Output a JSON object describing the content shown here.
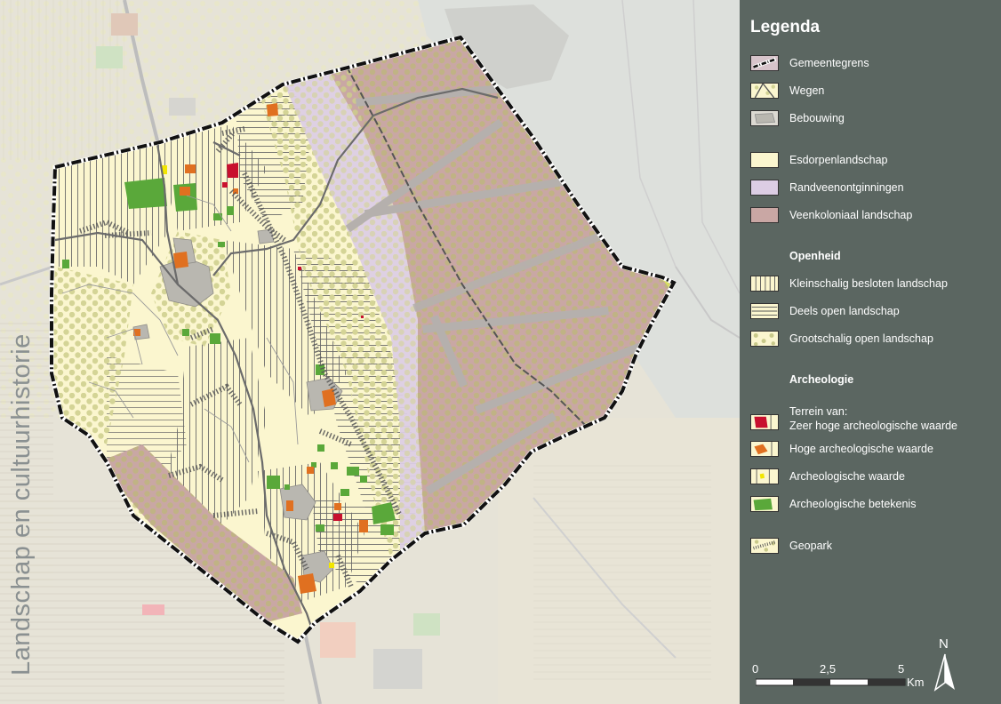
{
  "side_title": "Landschap en cultuurhistorie",
  "legend": {
    "title": "Legenda",
    "basis": [
      {
        "label": "Gemeentegrens",
        "icon": "municipal-border-swatch"
      },
      {
        "label": "Wegen",
        "icon": "roads-swatch"
      },
      {
        "label": "Bebouwing",
        "icon": "built-area-swatch"
      }
    ],
    "landschap": [
      {
        "label": "Esdorpenlandschap",
        "color": "#fbf6cf"
      },
      {
        "label": "Randveenontginningen",
        "color": "#dccde4"
      },
      {
        "label": "Veenkoloniaal landschap",
        "color": "#c9a7a4"
      }
    ],
    "openheid_title": "Openheid",
    "openheid": [
      {
        "label": "Kleinschalig besloten landschap",
        "pattern": "vertical-lines"
      },
      {
        "label": "Deels open landschap",
        "pattern": "horizontal-lines"
      },
      {
        "label": "Grootschalig open landschap",
        "pattern": "dots"
      }
    ],
    "archeologie_title": "Archeologie",
    "archeologie_subtitle": "Terrein van:",
    "archeologie": [
      {
        "label": "Zeer hoge archeologische waarde",
        "color": "#c8102e"
      },
      {
        "label": "Hoge archeologische waarde",
        "color": "#e07020"
      },
      {
        "label": "Archeologische waarde",
        "color": "#f2e600"
      },
      {
        "label": "Archeologische betekenis",
        "color": "#5aa83a"
      }
    ],
    "geopark": {
      "label": "Geopark",
      "pattern": "geopark-dots"
    }
  },
  "scalebar": {
    "ticks": [
      "0",
      "2,5",
      "5"
    ],
    "unit": "Km"
  },
  "north_label": "N",
  "colors": {
    "legend_bg": "#5b6661",
    "esdorp": "#fbf6cf",
    "randveen": "#dccde4",
    "veenkoloniaal": "#c9a7a4",
    "road": "#6b6b6b",
    "built": "#b9b7b0"
  }
}
